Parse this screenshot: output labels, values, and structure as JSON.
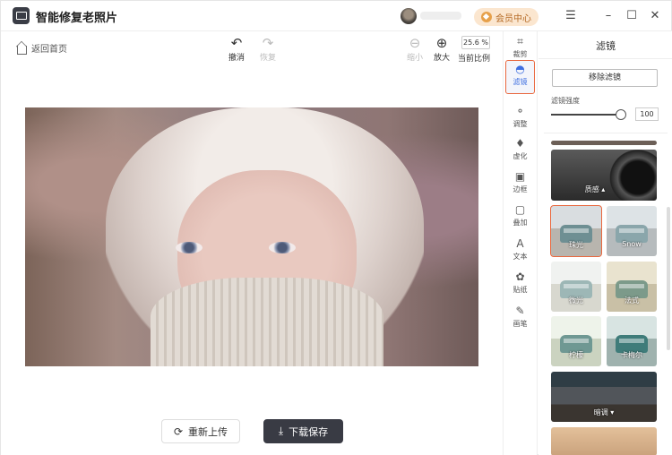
{
  "app": {
    "title": "智能修复老照片"
  },
  "header": {
    "vip_label": "会员中心"
  },
  "window_controls": {
    "menu": "☰",
    "minimize": "–",
    "maximize": "☐",
    "close": "✕"
  },
  "toolbar": {
    "back_label": "返回首页",
    "undo_label": "撤消",
    "redo_label": "恢复",
    "zoom_out_label": "缩小",
    "zoom_in_label": "放大",
    "zoom_value": "25.6 %",
    "zoom_current_label": "当前比例"
  },
  "actions": {
    "reupload_label": "重新上传",
    "save_label": "下载保存"
  },
  "rail": {
    "items": [
      {
        "label": "裁剪",
        "icon": "crop-icon"
      },
      {
        "label": "滤镜",
        "icon": "filter-drop-icon",
        "active": true
      },
      {
        "label": "调整",
        "icon": "adjust-icon"
      },
      {
        "label": "虚化",
        "icon": "blur-drop-icon"
      },
      {
        "label": "边框",
        "icon": "frame-icon"
      },
      {
        "label": "叠加",
        "icon": "overlay-icon"
      },
      {
        "label": "文本",
        "icon": "text-icon"
      },
      {
        "label": "贴纸",
        "icon": "sticker-icon"
      },
      {
        "label": "画笔",
        "icon": "brush-icon"
      }
    ]
  },
  "panel": {
    "title": "滤镜",
    "remove_label": "移除滤镜",
    "strength_label": "滤镜强度",
    "strength_value": "100",
    "strength_fraction": 1.0,
    "category_label": "质感",
    "category2_label": "暗调",
    "filters": [
      {
        "label": "珠光",
        "selected": true
      },
      {
        "label": "Snow"
      },
      {
        "label": "微光"
      },
      {
        "label": "法式"
      },
      {
        "label": "柠檬"
      },
      {
        "label": "卡梅尔"
      }
    ]
  },
  "colors": {
    "accent": "#e9683e",
    "active_blue": "#3f6fe0",
    "save_bg": "#393b44",
    "vip_bg": "#fbe6cf"
  }
}
